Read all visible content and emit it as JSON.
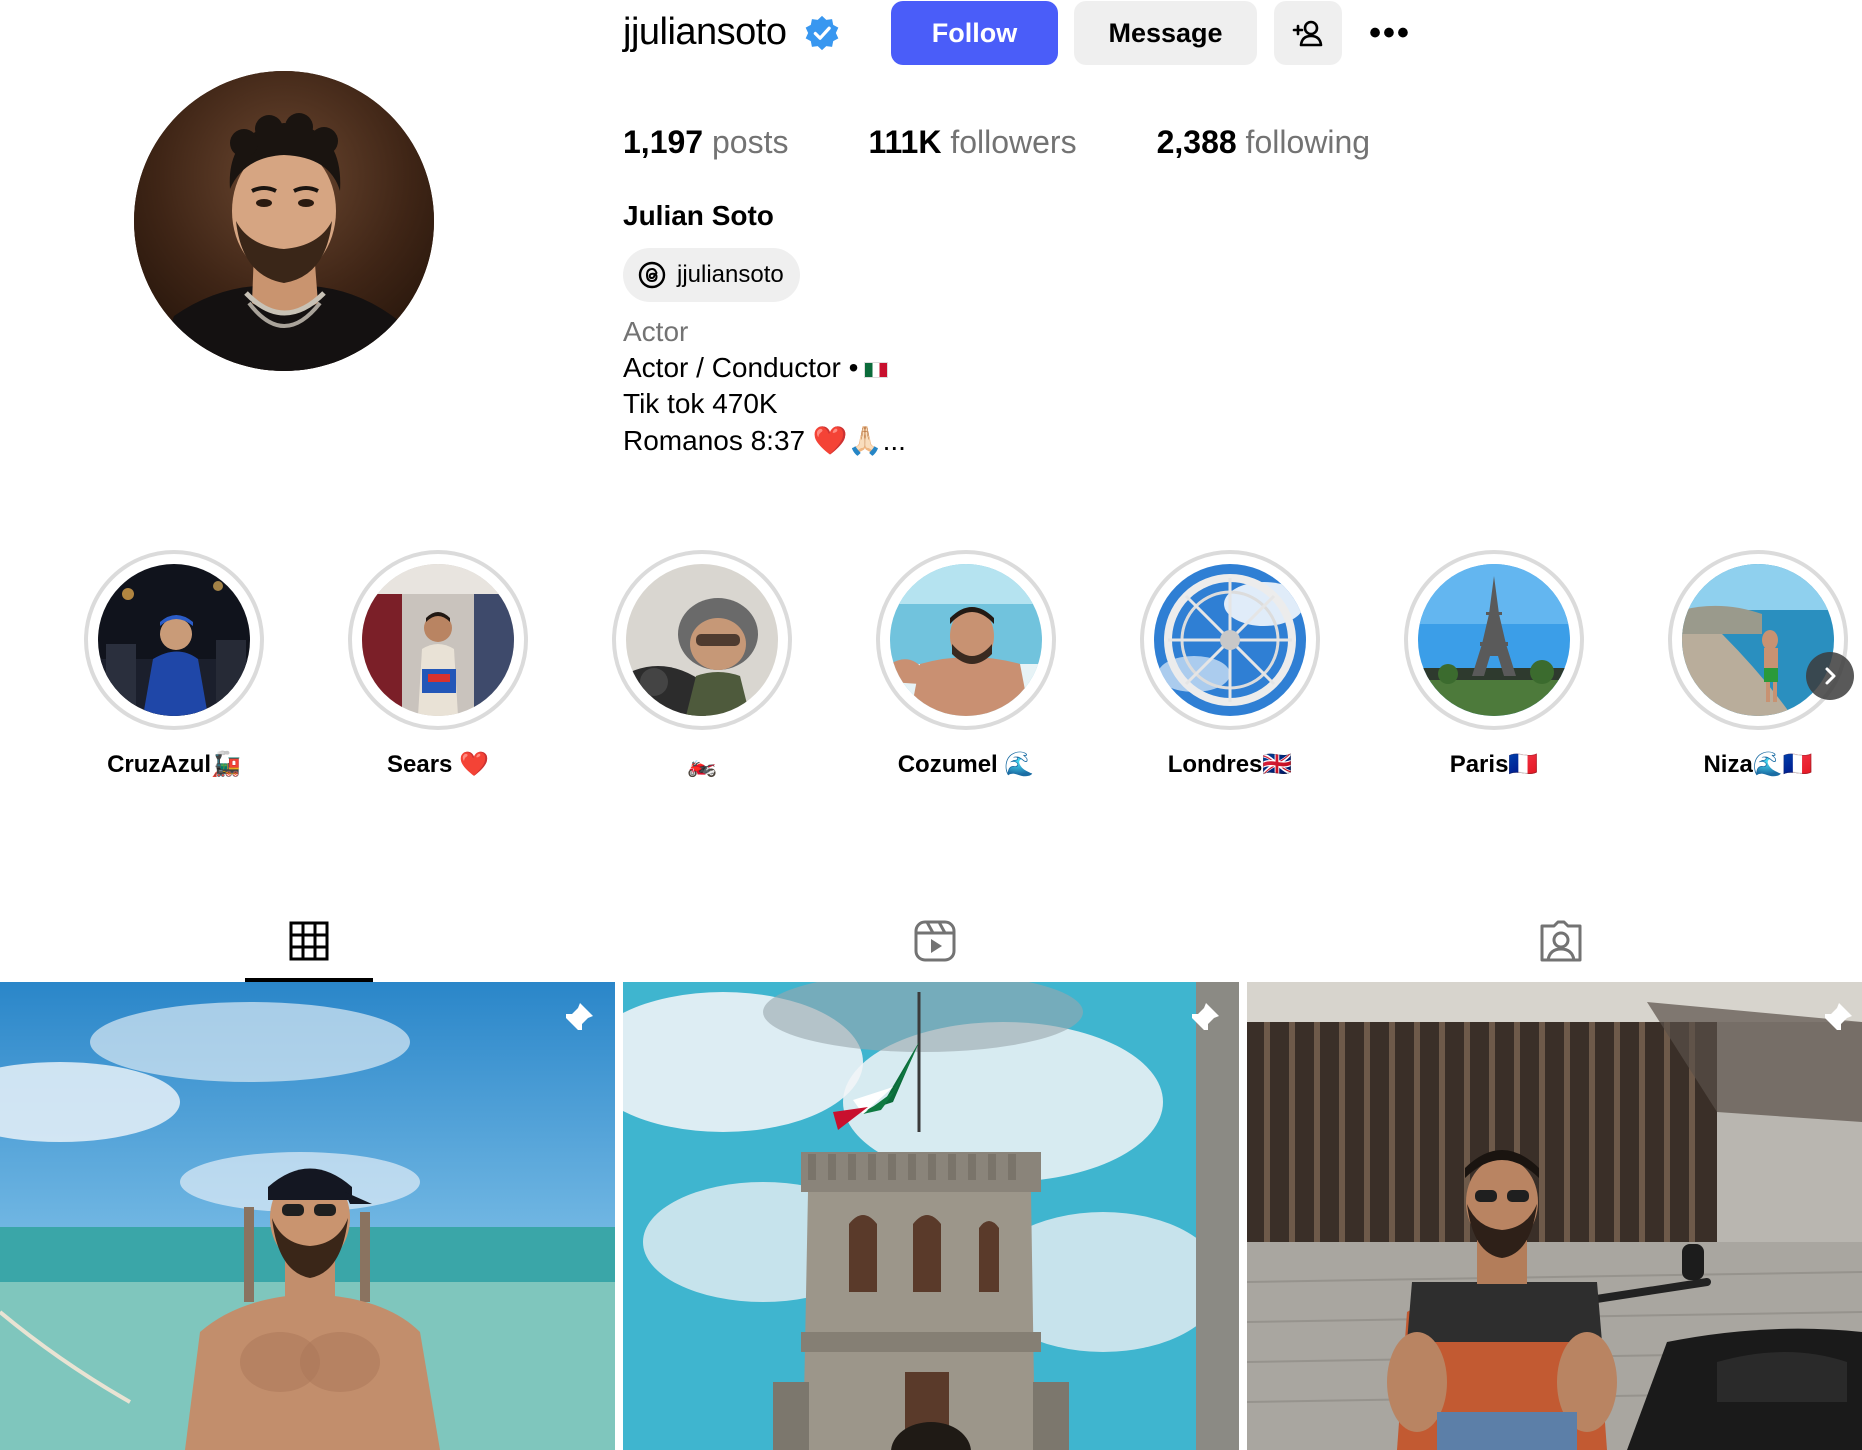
{
  "profile": {
    "username": "jjuliansoto",
    "verified_icon": "verified-badge-icon",
    "full_name": "Julian Soto",
    "threads_handle": "jjuliansoto",
    "category": "Actor",
    "bio": [
      "Actor / Conductor •",
      "Tik tok 470K",
      "Romanos 8:37 ❤️🙏🏻..."
    ]
  },
  "actions": {
    "follow_label": "Follow",
    "message_label": "Message",
    "add_user_icon": "add-user-icon",
    "more_label": "•••"
  },
  "stats": [
    {
      "value": "1,197",
      "label": "posts"
    },
    {
      "value": "111K",
      "label": "followers"
    },
    {
      "value": "2,388",
      "label": "following"
    }
  ],
  "highlights": [
    {
      "label": "CruzAzul🚂"
    },
    {
      "label": "Sears ❤️"
    },
    {
      "label": "🏍️"
    },
    {
      "label": "Cozumel 🌊"
    },
    {
      "label": "Londres🇬🇧"
    },
    {
      "label": "Paris🇫🇷"
    },
    {
      "label": "Niza🌊🇫🇷"
    }
  ],
  "tabs": [
    {
      "name": "posts",
      "icon": "grid-icon",
      "active": true
    },
    {
      "name": "reels",
      "icon": "reels-icon",
      "active": false
    },
    {
      "name": "tagged",
      "icon": "tagged-icon",
      "active": false
    }
  ],
  "posts": [
    {
      "pinned": true,
      "icon": "pin-icon"
    },
    {
      "pinned": true,
      "icon": "pin-icon"
    },
    {
      "pinned": true,
      "icon": "pin-icon"
    }
  ],
  "colors": {
    "follow_button": "#4a5df9",
    "secondary_button": "#efefef",
    "verified_badge": "#3897f0",
    "muted_text": "#737373"
  }
}
